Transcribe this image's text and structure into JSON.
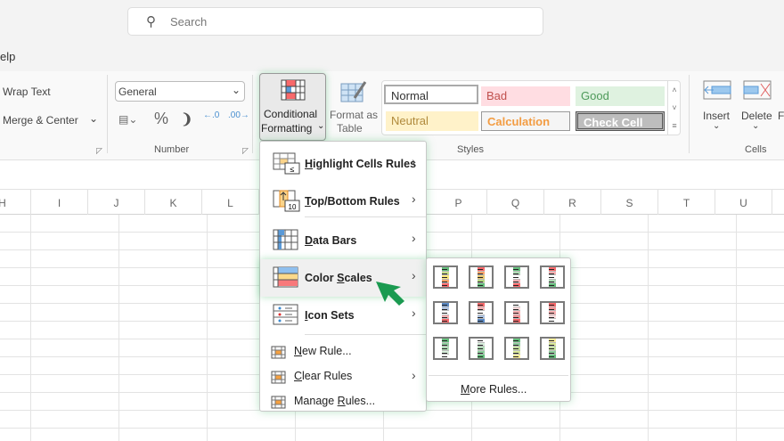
{
  "search": {
    "placeholder": "Search"
  },
  "menu_tab_fragment": "elp",
  "ribbon": {
    "alignment": {
      "wrap_text": "Wrap Text",
      "merge_center": "Merge & Center"
    },
    "number": {
      "format": "General",
      "percent": "%",
      "comma": "❩",
      "label": "Number"
    },
    "styles": {
      "conditional_formatting": [
        "Conditional",
        "Formatting"
      ],
      "format_as_table": [
        "Format as",
        "Table"
      ],
      "cells": [
        {
          "name": "Normal",
          "bg": "#ffffff",
          "fg": "#333333"
        },
        {
          "name": "Bad",
          "bg": "#ffdde2",
          "fg": "#c0504d"
        },
        {
          "name": "Good",
          "bg": "#dff2e0",
          "fg": "#4e9a5a"
        },
        {
          "name": "Neutral",
          "bg": "#fff2c9",
          "fg": "#b08a3c"
        },
        {
          "name": "Calculation",
          "bg": "#f5f5f5",
          "fg": "#f39c42"
        },
        {
          "name": "Check Cell",
          "bg": "#bdbdbd",
          "fg": "#ffffff"
        }
      ],
      "label": "Styles"
    },
    "cells": {
      "insert": "Insert",
      "delete": "Delete",
      "format_fragment": "F",
      "label": "Cells"
    }
  },
  "columns": [
    "H",
    "I",
    "J",
    "K",
    "L",
    "P",
    "Q",
    "R",
    "S",
    "T",
    "U"
  ],
  "cf_menu": {
    "items": [
      {
        "label": "Highlight Cells Rules",
        "u": "H",
        "rest": "ighlight Cells Rules"
      },
      {
        "label": "Top/Bottom Rules",
        "u": "T",
        "rest": "op/Bottom Rules"
      },
      {
        "label": "Data Bars",
        "u": "D",
        "rest": "ata Bars"
      },
      {
        "label": "Color Scales",
        "pre": "Color ",
        "u": "S",
        "rest": "cales"
      },
      {
        "label": "Icon Sets",
        "u": "I",
        "rest": "con Sets"
      }
    ],
    "small": [
      {
        "label": "New Rule...",
        "u": "N",
        "rest": "ew Rule..."
      },
      {
        "label": "Clear Rules",
        "u": "C",
        "rest": "lear Rules"
      },
      {
        "label": "Manage Rules...",
        "pre": "Manage ",
        "u": "R",
        "rest": "ules..."
      }
    ]
  },
  "color_scales": {
    "scales": [
      [
        "#63be7b",
        "#c6dd8c",
        "#fde97c",
        "#fba56a",
        "#f8696b"
      ],
      [
        "#f8696b",
        "#fba56a",
        "#e9c76f",
        "#b6d883",
        "#63be7b"
      ],
      [
        "#63be7b",
        "#b1dcb7",
        "#ffffff",
        "#fbb1b3",
        "#f8696b"
      ],
      [
        "#f8696b",
        "#fbb1b3",
        "#ffffff",
        "#b1dcb7",
        "#63be7b"
      ],
      [
        "#5a8ac6",
        "#aec4e4",
        "#ffffff",
        "#fbb1b3",
        "#f8696b"
      ],
      [
        "#f8696b",
        "#fbb1b3",
        "#ffffff",
        "#aec4e4",
        "#5a8ac6"
      ],
      [
        "#ffffff",
        "#fcd9da",
        "#fbb1b3",
        "#f99395",
        "#f8696b"
      ],
      [
        "#f8696b",
        "#f99395",
        "#fbb1b3",
        "#fcd9da",
        "#ffffff"
      ],
      [
        "#63be7b",
        "#8fcf9e",
        "#b1dcb7",
        "#d6ecda",
        "#ffffff"
      ],
      [
        "#ffffff",
        "#d6ecda",
        "#b1dcb7",
        "#8fcf9e",
        "#63be7b"
      ],
      [
        "#63be7b",
        "#8fcf9e",
        "#c5e1a0",
        "#dbe99a",
        "#ffef9c"
      ],
      [
        "#ffef9c",
        "#dbe99a",
        "#c5e1a0",
        "#8fcf9e",
        "#63be7b"
      ]
    ],
    "more_rules": {
      "u": "M",
      "rest": "ore Rules..."
    }
  }
}
